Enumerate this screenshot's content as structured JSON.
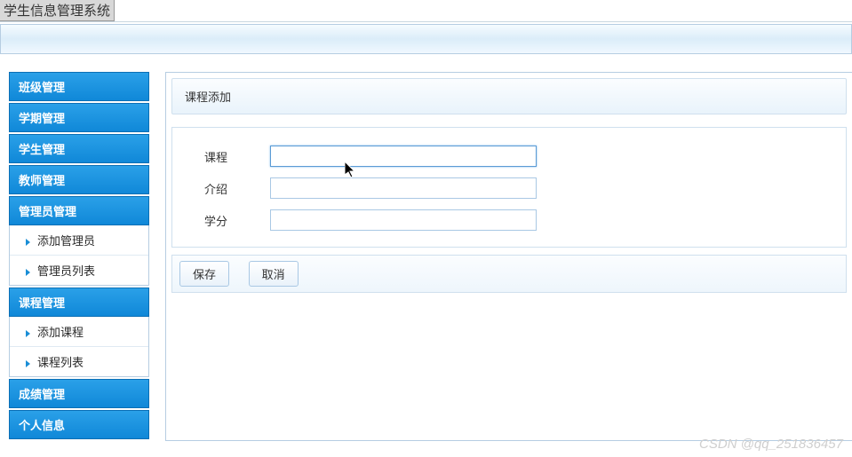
{
  "app_title": "学生信息管理系统",
  "sidebar": {
    "items": [
      {
        "label": "班级管理",
        "sub": []
      },
      {
        "label": "学期管理",
        "sub": []
      },
      {
        "label": "学生管理",
        "sub": []
      },
      {
        "label": "教师管理",
        "sub": []
      },
      {
        "label": "管理员管理",
        "sub": [
          "添加管理员",
          "管理员列表"
        ]
      },
      {
        "label": "课程管理",
        "sub": [
          "添加课程",
          "课程列表"
        ]
      },
      {
        "label": "成绩管理",
        "sub": []
      },
      {
        "label": "个人信息",
        "sub": []
      }
    ]
  },
  "panel": {
    "title": "课程添加",
    "fields": {
      "course_label": "课程",
      "intro_label": "介绍",
      "credit_label": "学分"
    },
    "buttons": {
      "save": "保存",
      "cancel": "取消"
    }
  },
  "watermark": "CSDN @qq_251836457"
}
